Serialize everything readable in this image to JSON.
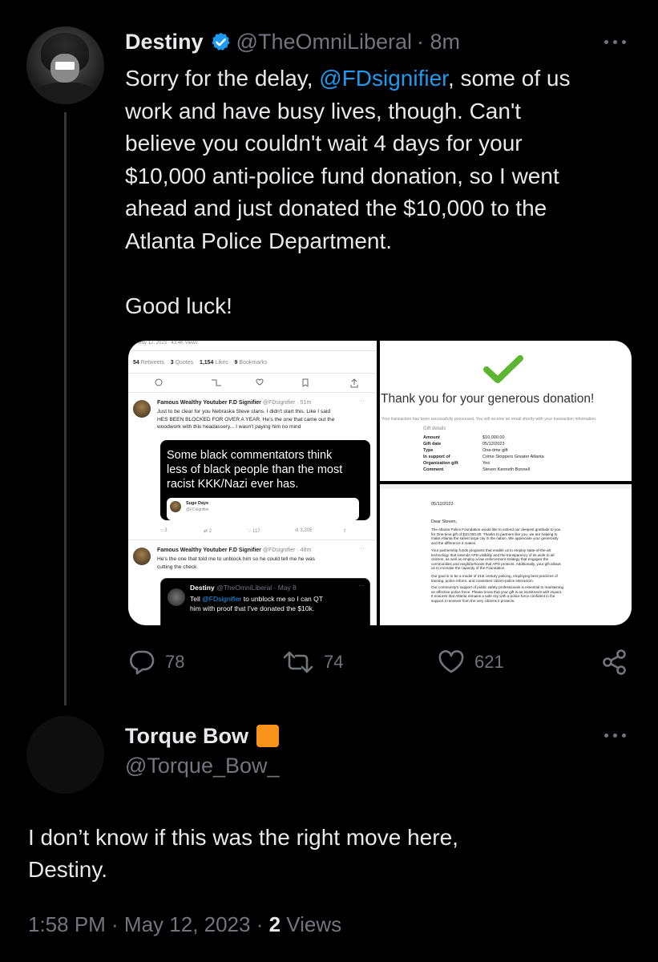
{
  "tweet": {
    "author_name": "Destiny",
    "handle": "@TheOmniLiberal",
    "time": "· 8m",
    "text_before": "Sorry for the delay, ",
    "mention": "@FDsignifier",
    "text_after": ", some of us\nwork and have busy lives, though. Can't\nbelieve you couldn't wait 4 days for your\n$10,000 anti-police fund donation, so I went\nahead and just donated the $10,000 to the\nAtlanta Police Department.\n\nGood luck!",
    "replies": "78",
    "retweets": "74",
    "likes": "621"
  },
  "media": {
    "left": {
      "stats": {
        "retweets_n": "54",
        "retweets_l": "Retweets",
        "quotes_n": "3",
        "quotes_l": "Quotes",
        "likes_n": "1,154",
        "likes_l": "Likes",
        "bookmarks_n": "9",
        "bookmarks_l": "Bookmarks"
      },
      "reply1": {
        "name": "Famous Wealthy Youtuber F.D Signifier",
        "handle": "@FDsignifier · 51m",
        "text": "Just to be clear for you Nebraska Steve stans. I didn't start this. Like I said\nHES BEEN BLOCKED FOR OVER A YEAR. He's the one that came out the\nwoodwork with this headassery... I wasn't paying him no mind"
      },
      "quote_card_text": "Some black commentators think\nless of black people than the most\nracist KKK/Nazi ever has.",
      "quote_card_author": "Suge Daye",
      "quote_card_handle": "@FDsignifier",
      "reply1_counts": {
        "replies": "3",
        "retweets": "2",
        "likes": "117",
        "views": "3,205"
      },
      "reply2": {
        "name": "Famous Wealthy Youtuber F.D Signifier",
        "handle": "@FDsignifier · 48m",
        "text": "He's the one that told me to unblock him so he could tell me he was\ncutting the check"
      },
      "quoted": {
        "name": "Destiny",
        "handle": "@TheOmniLiberal · May 8",
        "text_before": "Tell ",
        "mention": "@FDsignifier",
        "text_after": " to unblock me so I can QT\nhim with proof that I've donated the $10k."
      }
    },
    "right_top": {
      "title": "Thank you for your generous donation!",
      "subtitle": "Your transaction has been successfully processed. You will receive an email shortly with your transaction information.",
      "section": "Gift details",
      "rows": [
        {
          "label": "Amount",
          "value": "$10,000.00"
        },
        {
          "label": "Gift date",
          "value": "05/12/2023"
        },
        {
          "label": "Type",
          "value": "One-time gift"
        },
        {
          "label": "In support of",
          "value": "Crime Stoppers Greater Atlanta"
        },
        {
          "label": "Organization gift",
          "value": "Yes"
        },
        {
          "label": "Comment",
          "value": "Steven Kenneth Bonnell"
        }
      ]
    },
    "right_bottom": {
      "date": "05/12/2023",
      "greeting": "Dear Steven,",
      "p1": "The Atlanta Police Foundation would like to extend our deepest gratitude to you\nfor One-time gift of $10,000.00. Thanks to partners like you, we are helping to\nmake Atlanta the safest large city in the nation. We appreciate your generosity\nand the difference it makes.",
      "p2": "Your partnership funds programs that enable us to employ state-of-the-art\ntechnology that extends APD visibility and the transparency of its work to all\ncitizens, as well as employ a law enforcement strategy that engages the\ncommunities and neighborhoods that APD protects. Additionally, your gift allows\nus to increase the capacity of the Foundation.",
      "p3": "Our goal is to be a model of 21st century policing, employing best practices of\ntraining, police reform, and consistent citizen-police interaction.",
      "p4": "Our community's support of public safety professionals is essential to maintaining\nan effective police force. Please know that your gift is an investment with impact.\nIt ensures that Atlanta remains a safe city with a police force confident in the\nsupport it receives from the very citizens it protects."
    }
  },
  "reply": {
    "author_name": "Torque Bow",
    "handle": "@Torque_Bow_",
    "text": "I don’t know if this was the right move here,\nDestiny.",
    "time": "1:58 PM · May 12, 2023 · ",
    "views_count": "2",
    "views_label": " Views"
  },
  "icons": [
    "more-icon",
    "reply-icon",
    "retweet-icon",
    "like-icon",
    "share-icon",
    "verified-icon",
    "checkmark-icon"
  ],
  "colors": {
    "accent": "#1d9bf0",
    "muted": "#71767b",
    "text": "#e7e9ea",
    "check_green": "#5cb531",
    "orange_badge": "#f7931a"
  }
}
